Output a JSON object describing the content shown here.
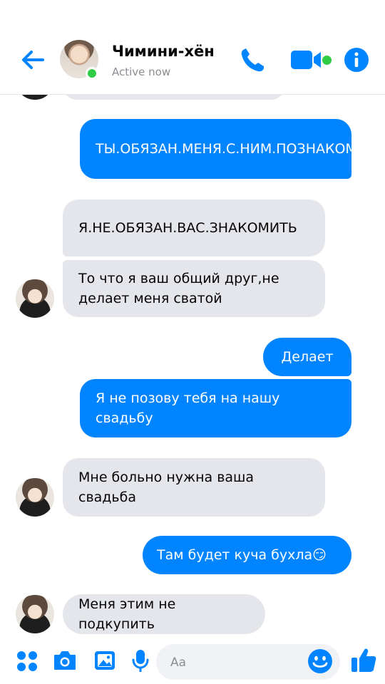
{
  "header": {
    "contact_name": "Чимини-хён",
    "status": "Active now"
  },
  "messages": [
    {
      "direction": "out",
      "text": "ТЫ.ОБЯЗАН.МЕНЯ.С.НИМ.ПОЗНАКОМИТЬ."
    },
    {
      "direction": "in",
      "text": "Я.НЕ.ОБЯЗАН.ВАС.ЗНАКОМИТЬ"
    },
    {
      "direction": "in",
      "text": "То что я ваш общий друг,не делает меня сватой"
    },
    {
      "direction": "out",
      "text": "Делает"
    },
    {
      "direction": "out",
      "text": "Я не позову тебя на нашу свадьбу"
    },
    {
      "direction": "in",
      "text": "Мне больно нужна ваша свадьба"
    },
    {
      "direction": "out",
      "text": "Там будет куча бухла😏"
    },
    {
      "direction": "in",
      "text": "Меня этим не подкупить"
    }
  ],
  "composer": {
    "placeholder": "Aa"
  },
  "colors": {
    "accent": "#0084ff",
    "incoming_bubble": "#e4e6eb",
    "online": "#31cc46"
  },
  "icons": [
    "back-arrow-icon",
    "phone-icon",
    "video-camera-icon",
    "info-icon",
    "apps-grid-icon",
    "camera-icon",
    "gallery-icon",
    "microphone-icon",
    "emoji-icon",
    "thumbs-up-icon"
  ]
}
